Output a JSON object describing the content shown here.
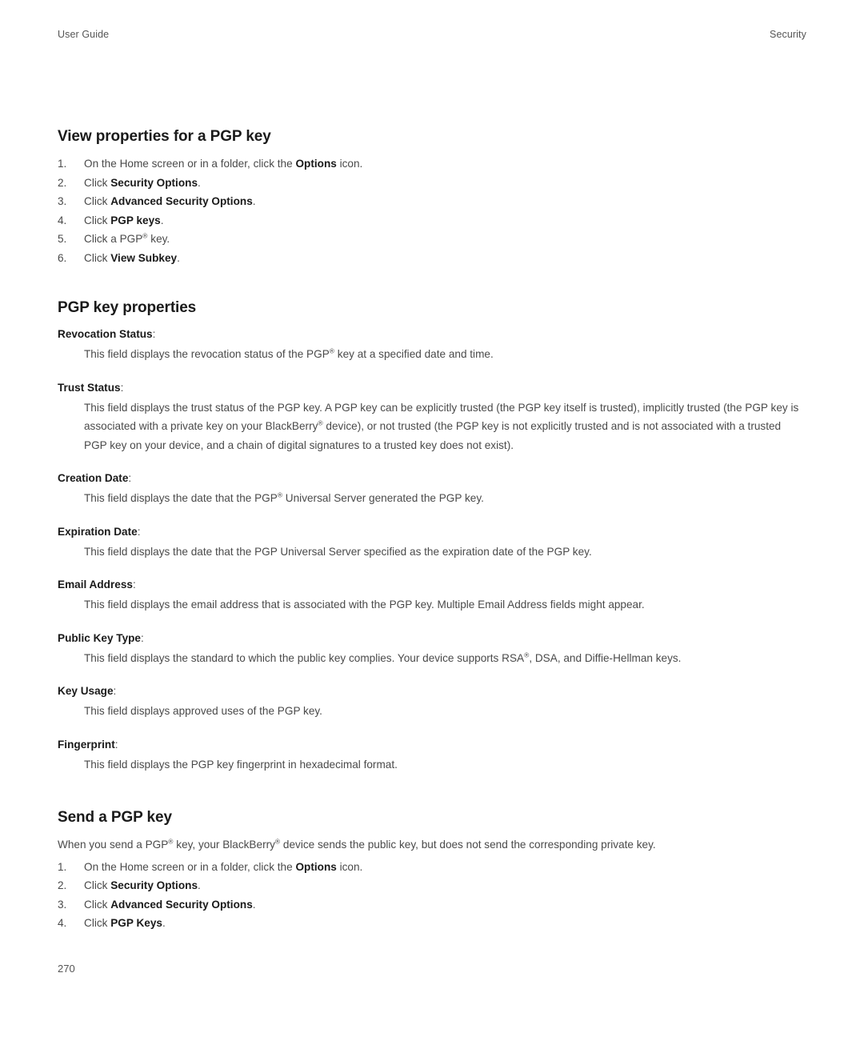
{
  "running_head": {
    "left": "User Guide",
    "right": "Security"
  },
  "sections": [
    {
      "heading": "View properties for a PGP key",
      "steps": [
        {
          "num": "1.",
          "pre": "On the Home screen or in a folder, click the ",
          "bold": "Options",
          "post": " icon."
        },
        {
          "num": "2.",
          "pre": "Click ",
          "bold": "Security Options",
          "post": "."
        },
        {
          "num": "3.",
          "pre": "Click ",
          "bold": "Advanced Security Options",
          "post": "."
        },
        {
          "num": "4.",
          "pre": "Click ",
          "bold": "PGP keys",
          "post": "."
        },
        {
          "num": "5.",
          "pre": "Click a PGP® key.",
          "bold": "",
          "post": ""
        },
        {
          "num": "6.",
          "pre": "Click ",
          "bold": "View Subkey",
          "post": "."
        }
      ]
    }
  ],
  "properties_section": {
    "heading": "PGP key properties",
    "items": [
      {
        "term": "Revocation Status",
        "body": "This field displays the revocation status of the PGP® key at a specified date and time."
      },
      {
        "term": "Trust Status",
        "body": "This field displays the trust status of the PGP key. A PGP key can be explicitly trusted (the PGP key itself is trusted), implicitly trusted (the PGP key is associated with a private key on your BlackBerry® device), or not trusted (the PGP key is not explicitly trusted and is not associated with a trusted PGP key on your device, and a chain of digital signatures to a trusted key does not exist)."
      },
      {
        "term": "Creation Date",
        "body": "This field displays the date that the PGP® Universal Server generated the PGP key."
      },
      {
        "term": "Expiration Date",
        "body": "This field displays the date that the PGP Universal Server specified as the expiration date of the PGP key."
      },
      {
        "term": "Email Address",
        "body": "This field displays the email address that is associated with the PGP key. Multiple Email Address fields might appear."
      },
      {
        "term": "Public Key Type",
        "body": "This field displays the standard to which the public key complies. Your device supports RSA®, DSA, and Diffie-Hellman keys."
      },
      {
        "term": "Key Usage",
        "body": "This field displays approved uses of the PGP key."
      },
      {
        "term": "Fingerprint",
        "body": "This field displays the PGP key fingerprint in hexadecimal format."
      }
    ]
  },
  "send_section": {
    "heading": "Send a PGP key",
    "intro": "When you send a PGP® key, your BlackBerry® device sends the public key, but does not send the corresponding private key.",
    "steps": [
      {
        "num": "1.",
        "pre": "On the Home screen or in a folder, click the ",
        "bold": "Options",
        "post": " icon."
      },
      {
        "num": "2.",
        "pre": "Click ",
        "bold": "Security Options",
        "post": "."
      },
      {
        "num": "3.",
        "pre": "Click ",
        "bold": "Advanced Security Options",
        "post": "."
      },
      {
        "num": "4.",
        "pre": "Click ",
        "bold": "PGP Keys",
        "post": "."
      }
    ]
  },
  "folio": "270"
}
